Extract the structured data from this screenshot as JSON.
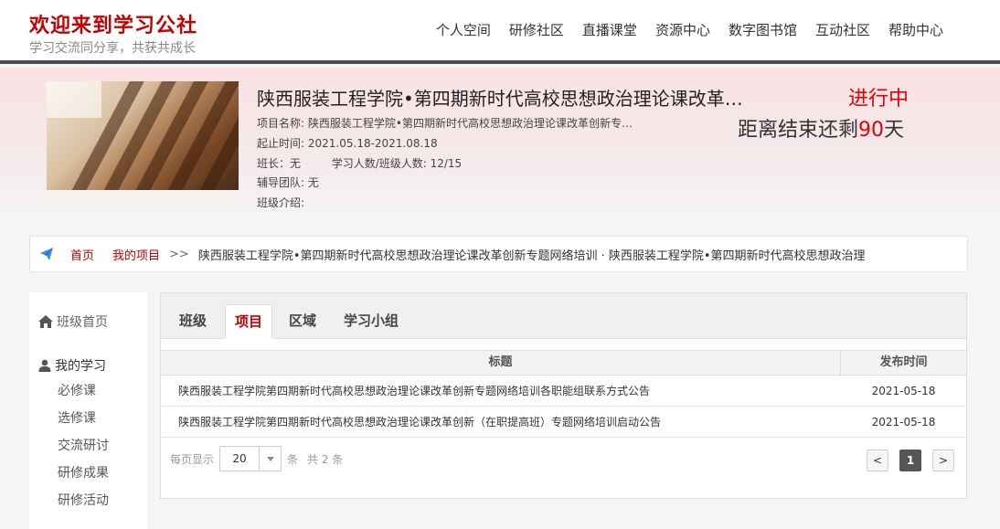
{
  "header": {
    "site_title": "欢迎来到学习公社",
    "site_subtitle": "学习交流同分享，共获共成长",
    "nav": [
      "个人空间",
      "研修社区",
      "直播课堂",
      "资源中心",
      "数字图书馆",
      "互动社区",
      "帮助中心"
    ]
  },
  "project": {
    "title": "陕西服装工程学院•第四期新时代高校思想政治理论课改革…",
    "status": "进行中",
    "countdown_prefix": "距离结束还剩",
    "countdown_days": "90",
    "countdown_suffix": "天",
    "name_label": "项目名称:",
    "name_value": "陕西服装工程学院•第四期新时代高校思想政治理论课改革创新专…",
    "time_label": "起止时间:",
    "time_value": "2021.05.18-2021.08.18",
    "leader_label": "班长：",
    "leader_value": "无",
    "count_label": "学习人数/班级人数:",
    "count_value": "12/15",
    "team_label": "辅导团队:",
    "team_value": "无",
    "intro_label": "班级介绍:"
  },
  "breadcrumb": {
    "home": "首页",
    "my_projects": "我的项目",
    "separator": ">>",
    "path": "陕西服装工程学院•第四期新时代高校思想政治理论课改革创新专题网络培训 · 陕西服装工程学院•第四期新时代高校思想政治理"
  },
  "sidebar": {
    "class_home": "班级首页",
    "my_study": "我的学习",
    "items": [
      "必修课",
      "选修课",
      "交流研讨",
      "研修成果",
      "研修活动"
    ]
  },
  "tabs": [
    "班级",
    "项目",
    "区域",
    "学习小组"
  ],
  "table": {
    "col_title": "标题",
    "col_date": "发布时间",
    "rows": [
      {
        "title": "陕西服装工程学院第四期新时代高校思想政治理论课改革创新专题网络培训各职能组联系方式公告",
        "date": "2021-05-18"
      },
      {
        "title": "陕西服装工程学院第四期新时代高校思想政治理论课改革创新（在职提高班）专题网络培训启动公告",
        "date": "2021-05-18"
      }
    ]
  },
  "pager": {
    "per_page_label": "每页显示",
    "per_page_value": "20",
    "unit": "条",
    "total": "共 2 条",
    "prev": "<",
    "current": "1",
    "next": ">"
  },
  "colors": {
    "brand_red": "#c40000",
    "status_red": "#e60000",
    "header_bar": "#4a4a58"
  }
}
